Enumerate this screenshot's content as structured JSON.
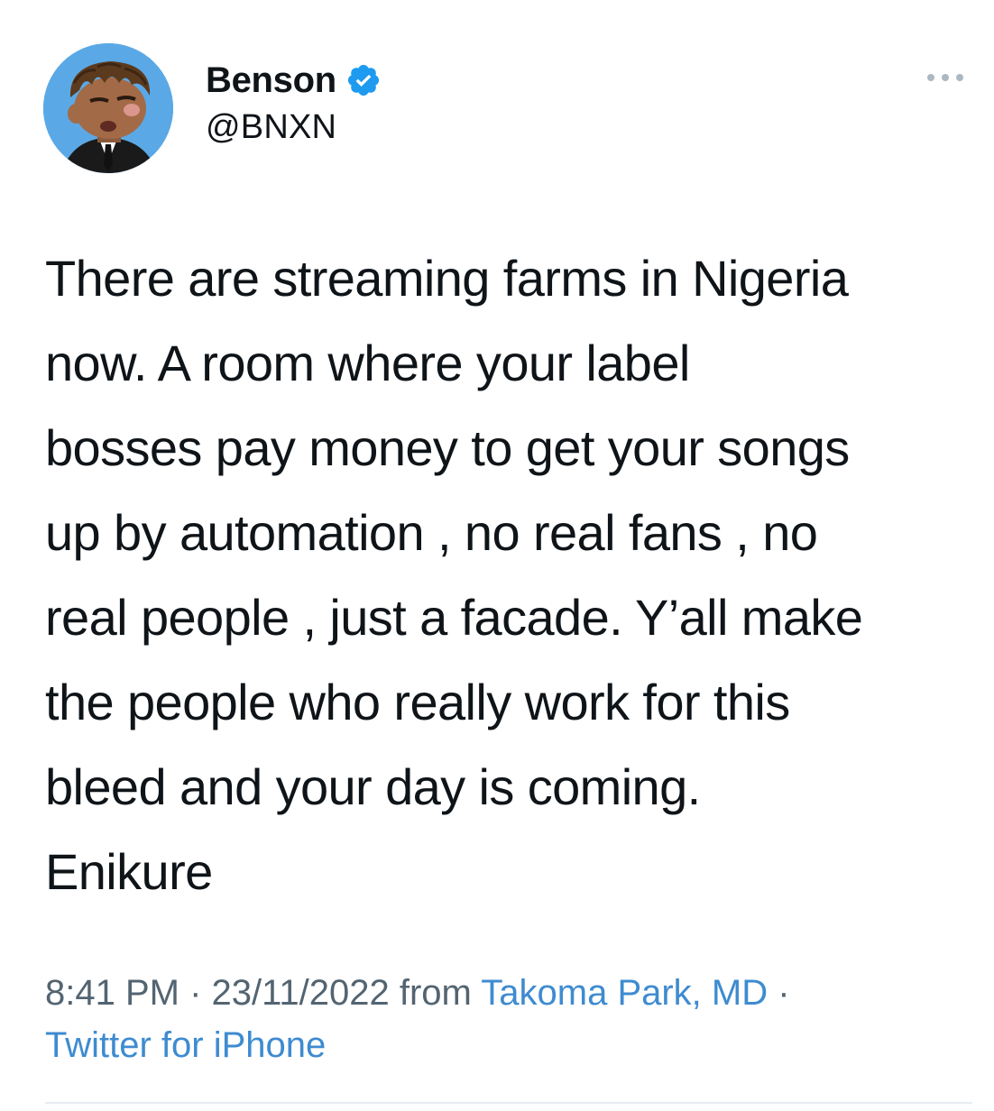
{
  "author": {
    "display_name": "Benson",
    "handle": "@BNXN",
    "verified": true,
    "avatar_icon": "cartoon-avatar",
    "verified_icon": "verified-badge-icon"
  },
  "more_icon": "more-options-icon",
  "tweet": {
    "text": "There are streaming farms in Nigeria\nnow. A room where your label\nbosses pay money to get your songs\nup by automation , no real fans , no\nreal people , just a facade. Y’all make\nthe people who really work for this\nbleed and your day is coming.\nEnikure"
  },
  "meta": {
    "time": "8:41 PM",
    "sep1": " · ",
    "date": "23/11/2022",
    "from": " from ",
    "location": "Takoma Park, MD",
    "sep2": " · ",
    "source": "Twitter for iPhone"
  },
  "colors": {
    "link": "#3e8bd0",
    "verified": "#1d9bf0",
    "muted": "#536471",
    "text": "#0f1419"
  }
}
